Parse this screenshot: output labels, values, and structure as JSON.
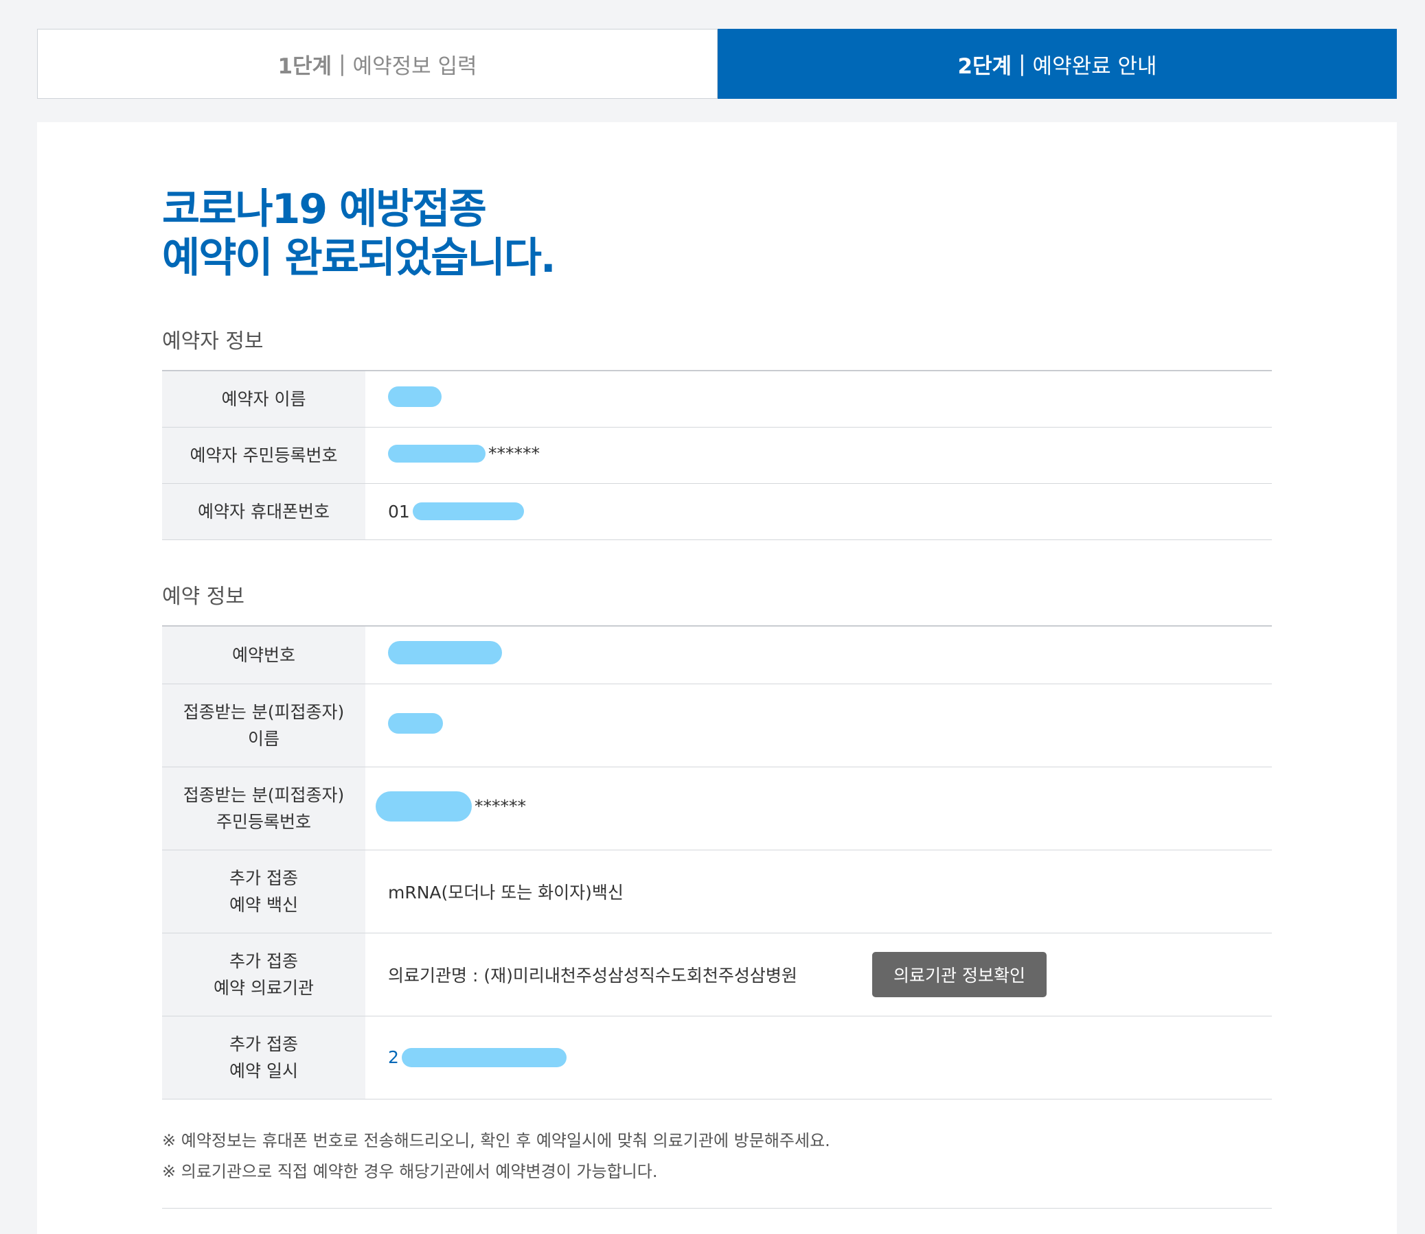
{
  "steps": [
    {
      "num": "1단계",
      "sep": "|",
      "label": "예약정보 입력"
    },
    {
      "num": "2단계",
      "sep": "|",
      "label": "예약완료 안내"
    }
  ],
  "headline": {
    "line1": "코로나19 예방접종",
    "line2": "예약이 완료되었습니다."
  },
  "reserver_section": {
    "title": "예약자 정보",
    "rows": [
      {
        "label": "예약자 이름",
        "value_prefix": "",
        "value_suffix": ""
      },
      {
        "label": "예약자 주민등록번호",
        "value_prefix": "",
        "value_suffix": "******"
      },
      {
        "label": "예약자 휴대폰번호",
        "value_prefix": "01",
        "value_suffix": ""
      }
    ]
  },
  "reservation_section": {
    "title": "예약 정보",
    "number_label": "예약번호",
    "recipient_name_label": [
      "접종받는 분(피접종자)",
      "이름"
    ],
    "recipient_id_label": [
      "접종받는 분(피접종자)",
      "주민등록번호"
    ],
    "recipient_id_suffix": "******",
    "vaccine_label": [
      "추가 접종",
      "예약 백신"
    ],
    "vaccine_value": "mRNA(모더나 또는 화이자)백신",
    "institution_label": [
      "추가 접종",
      "예약 의료기관"
    ],
    "institution_value": "의료기관명 : (재)미리내천주성삼성직수도회천주성삼병원",
    "institution_button": "의료기관 정보확인",
    "datetime_label": [
      "추가 접종",
      "예약 일시"
    ],
    "datetime_prefix": "2"
  },
  "notes": [
    "※ 예약정보는 휴대폰 번호로 전송해드리오니, 확인 후 예약일시에 맞춰 의료기관에 방문해주세요.",
    "※ 의료기관으로 직접 예약한 경우 해당기관에서 예약변경이 가능합니다."
  ],
  "colors": {
    "primary": "#0068b7",
    "button": "#676767",
    "mask": "#85d4fb"
  }
}
